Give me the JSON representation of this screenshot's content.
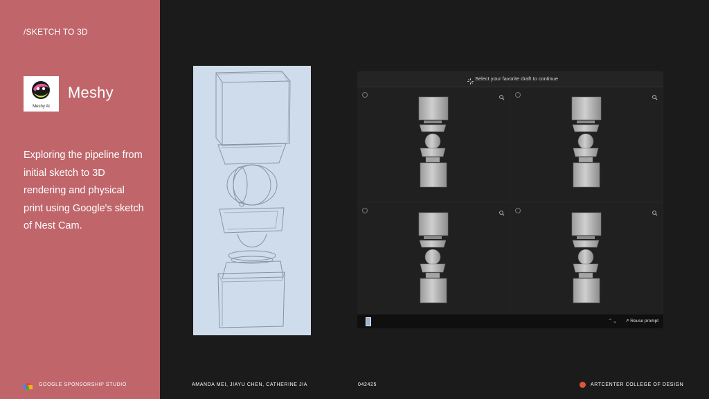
{
  "sidebar": {
    "section_label": "/SKETCH TO 3D",
    "logo_caption": "Meshy AI",
    "brand": "Meshy",
    "description": "Exploring the pipeline from initial sketch to 3D rendering and physical print using Google's sketch of Nest Cam."
  },
  "panel": {
    "header": "Select your favorite draft to continue",
    "reuse_label": "Reuse prompt",
    "stepper": "⌃⌄",
    "drafts": [
      {
        "icon": "zoom-in-icon"
      },
      {
        "icon": "zoom-in-icon"
      },
      {
        "icon": "zoom-in-icon"
      },
      {
        "icon": "zoom-in-icon"
      }
    ]
  },
  "footer": {
    "sponsor": "GOOGLE SPONSORSHIP STUDIO",
    "names": "AMANDA MEI, JIAYU CHEN, CATHERINE JIA",
    "date": "042425",
    "school": "ARTCENTER COLLEGE OF DESIGN"
  },
  "colors": {
    "sidebar_bg": "#c0666b",
    "page_bg": "#1b1b1b",
    "sketch_bg": "#cfdcec",
    "accent_dot": "#e2543a"
  }
}
